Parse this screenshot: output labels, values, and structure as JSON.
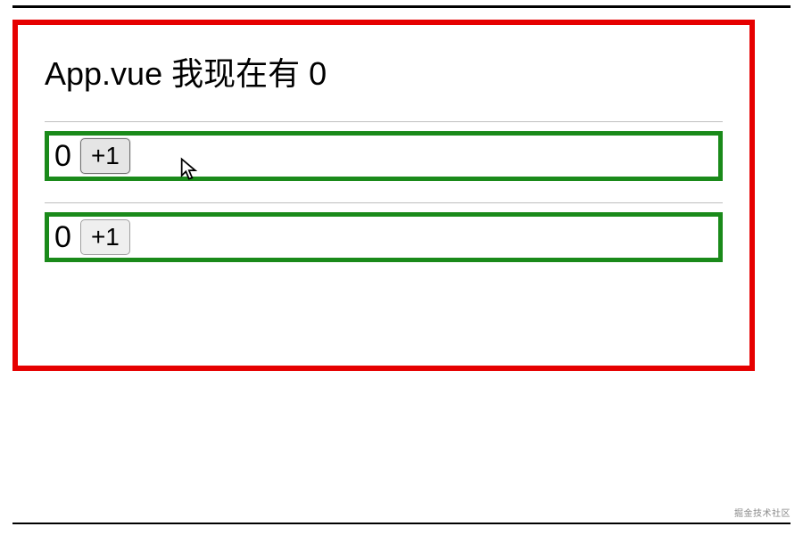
{
  "heading": {
    "prefix": "App.vue 我现在有",
    "value": "0"
  },
  "counters": [
    {
      "value": "0",
      "button_label": "+1",
      "hovered": true
    },
    {
      "value": "0",
      "button_label": "+1",
      "hovered": false
    }
  ],
  "watermark": "掘金技术社区"
}
